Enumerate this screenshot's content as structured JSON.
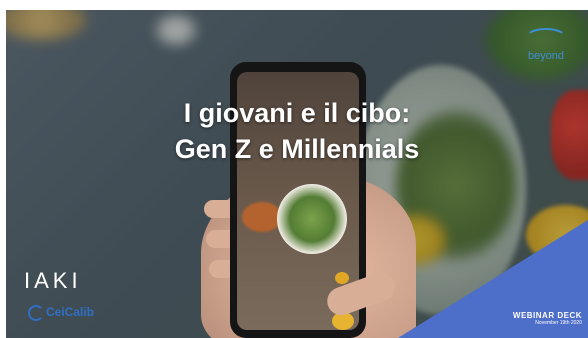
{
  "slide": {
    "title_line1": "I giovani e il cibo:",
    "title_line2": "Gen Z e Millennials"
  },
  "logos": {
    "top_right": "beyond",
    "bottom_left_primary": "IAKI",
    "bottom_left_secondary": "CeiCalib"
  },
  "corner": {
    "label": "WEBINAR DECK",
    "date": "November 19th 2020"
  },
  "colors": {
    "corner_blue": "#4d6ec9",
    "title_text": "#ffffff"
  }
}
